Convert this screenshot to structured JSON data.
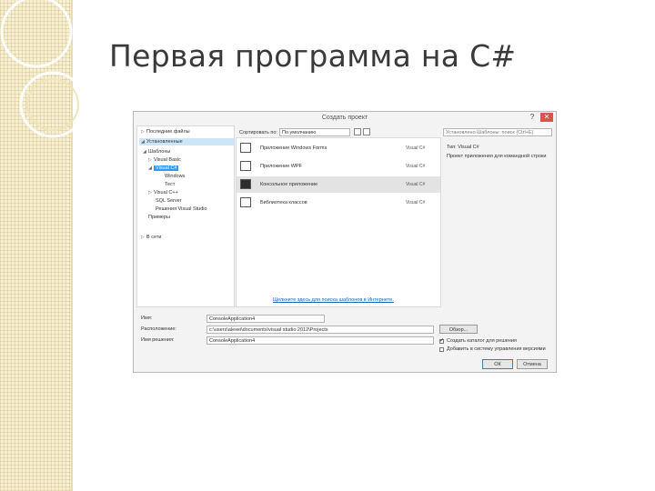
{
  "slide": {
    "title": "Первая программа на C#"
  },
  "dialog": {
    "title": "Создать проект",
    "help": "?",
    "close": "✕",
    "sort_label": "Сортировать по:",
    "sort_value": "По умолчанию",
    "search_placeholder": "Установлено Шаблоны: поиск (Ctrl+E)",
    "left_pane": {
      "items": [
        {
          "label": "Последние файлы",
          "arrow": "▷"
        },
        {
          "label": "Установленные",
          "arrow": "◢"
        },
        {
          "label": "Шаблоны",
          "arrow": "◢"
        },
        {
          "label": "Visual Basic",
          "arrow": "▷"
        },
        {
          "label": "Visual C#",
          "arrow": "◢"
        },
        {
          "label": "Windows",
          "arrow": ""
        },
        {
          "label": "Тест",
          "arrow": ""
        },
        {
          "label": "Visual C++",
          "arrow": "▷"
        },
        {
          "label": "SQL Server",
          "arrow": ""
        },
        {
          "label": "Решения Visual Studio",
          "arrow": ""
        },
        {
          "label": "Примеры",
          "arrow": ""
        },
        {
          "label": "В сети",
          "arrow": "▷"
        }
      ]
    },
    "templates": [
      {
        "name": "Приложение Windows Forms",
        "lang": "Visual C#",
        "icon": "windows-forms-icon"
      },
      {
        "name": "Приложение WPF",
        "lang": "Visual C#",
        "icon": "wpf-app-icon"
      },
      {
        "name": "Консольное приложение",
        "lang": "Visual C#",
        "icon": "console-app-icon"
      },
      {
        "name": "Библиотека классов",
        "lang": "Visual C#",
        "icon": "class-library-icon"
      }
    ],
    "online_link": "Щелкните здесь для поиска шаблонов в Интернете.",
    "right_pane": {
      "type": "Тип: Visual C#",
      "description": "Проект приложения для командной строки"
    },
    "fields": {
      "name_label": "Имя:",
      "name_value": "ConsoleApplication4",
      "location_label": "Расположение:",
      "location_value": "c:\\users\\alexei\\documents\\visual studio 2012\\Projects",
      "solution_label": "Имя решения:",
      "solution_value": "ConsoleApplication4"
    },
    "browse_label": "Обзор...",
    "checkboxes": [
      {
        "label": "Создать каталог для решения",
        "checked": true
      },
      {
        "label": "Добавить в систему управления версиями",
        "checked": false
      }
    ],
    "ok_label": "ОК",
    "cancel_label": "Отмена"
  }
}
